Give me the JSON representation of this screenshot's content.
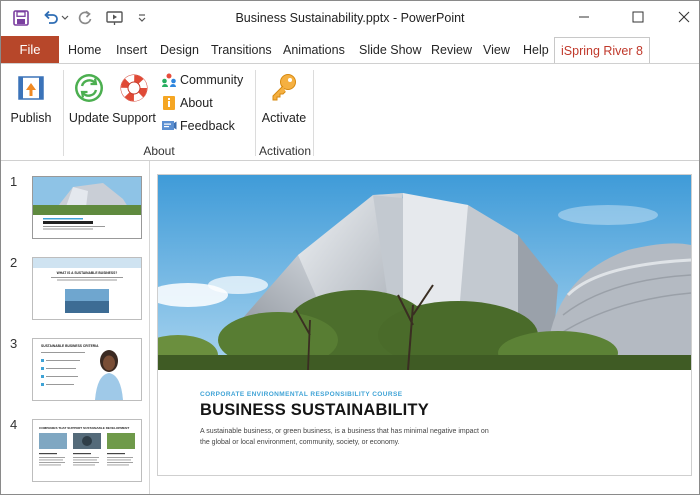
{
  "window": {
    "title": "Business Sustainability.pptx  -  PowerPoint"
  },
  "quick_access": {
    "save_icon": "save-icon",
    "undo_icon": "undo-icon",
    "redo_icon": "redo-icon",
    "present_icon": "start-from-beginning-icon",
    "customize_icon": "customize-qat-icon"
  },
  "tabs": {
    "file": "File",
    "items": [
      "Home",
      "Insert",
      "Design",
      "Transitions",
      "Animations",
      "Slide Show",
      "Review",
      "View",
      "Help"
    ],
    "active": "iSpring River 8"
  },
  "ribbon": {
    "publish": "Publish",
    "update": "Update",
    "support": "Support",
    "community": "Community",
    "about_link": "About",
    "feedback": "Feedback",
    "group_about": "About",
    "activate": "Activate",
    "group_activation": "Activation"
  },
  "slides": {
    "numbers": [
      "1",
      "2",
      "3",
      "4"
    ],
    "thumb2_title": "WHAT IS A SUSTAINABLE BUSINESS?",
    "thumb3_title": "SUSTAINABLE BUSINESS CRITERIA",
    "thumb4_title": "COMPANIES THAT SUPPORT SUSTAINABLE DEVELOPMENT"
  },
  "current_slide": {
    "eyebrow": "CORPORATE ENVIRONMENTAL RESPONSIBILITY COURSE",
    "title": "BUSINESS SUSTAINABILITY",
    "body": "A sustainable business, or green business, is a business that has minimal negative impact on the global or local environment, community, society, or economy."
  },
  "colors": {
    "file_tab": "#b7472a",
    "active_tab_text": "#c0392b",
    "accent_blue": "#3fa3d6"
  }
}
